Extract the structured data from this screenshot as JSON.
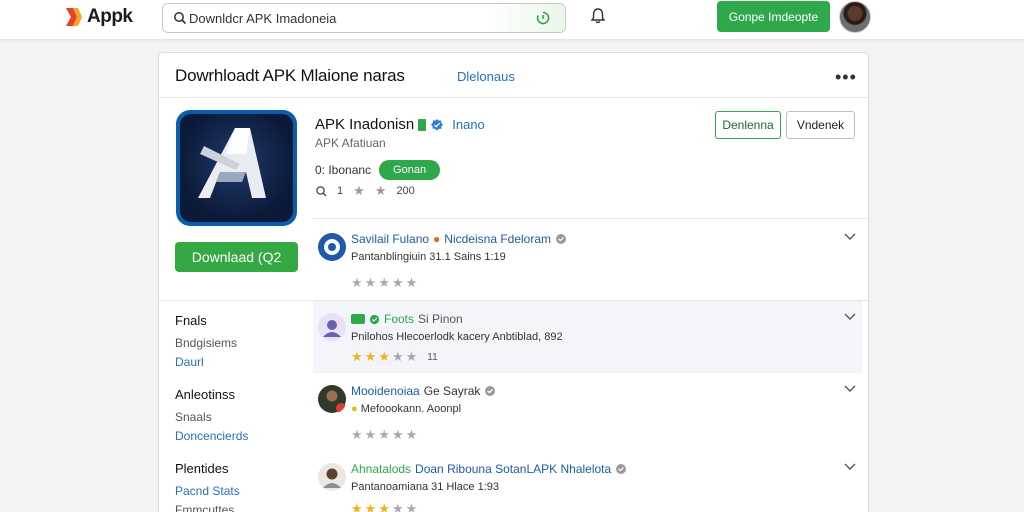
{
  "topbar": {
    "logo_text": "Αppk",
    "search_value": "Downldcr APK Imadoneia",
    "cta_label": "Gonpe Imdeopte",
    "icons": [
      "logo-icon",
      "search-icon",
      "refresh-icon",
      "bell-icon",
      "avatar"
    ]
  },
  "card": {
    "title": "Dowrhloadt APK Mlaione naras",
    "breadcrumb": "Dlelonaus",
    "more": "•••"
  },
  "app": {
    "name": "APK Inadonisn",
    "developer": "Inano",
    "subtitle": "APK Afatiuan",
    "meta_label": "0: Ibonanc",
    "pill_label": "Gonan",
    "stats_a": "1",
    "stats_b": "200",
    "download_label": "Downlaad  (Q2",
    "btn_primary": "Denlenna",
    "btn_secondary": "Vndenek"
  },
  "sidebar": {
    "groups": [
      {
        "head": "Fnals",
        "links": [
          {
            "label": "Bndgisiems",
            "style": "gray"
          },
          {
            "label": "Daurl",
            "style": "blue"
          }
        ]
      },
      {
        "head": "Anleotinss",
        "links": [
          {
            "label": "Snaals",
            "style": "gray"
          },
          {
            "label": "Doncencierds",
            "style": "blue"
          }
        ]
      },
      {
        "head": "Plentides",
        "links": [
          {
            "label": "Pacnd Stats",
            "style": "blue"
          },
          {
            "label": "Fmmcuttes",
            "style": "gray"
          }
        ]
      }
    ]
  },
  "reviews": [
    {
      "name_a": "Savilail Fulano",
      "name_b": "Nicdeisna Fdeloram",
      "body": "Pantanblingiuin 31.1 Sains 1:19",
      "stars": 0,
      "count": ""
    },
    {
      "name_a": "Foots",
      "name_b": "Si Pinon",
      "body": "Pnilohos Hlecoerlodk kacery Anbtiblad, 892",
      "stars": 3,
      "count": "11"
    },
    {
      "name_a": "Mooidenoiaa",
      "name_b": "Ge Sayrak",
      "body": "Mefoookann. Aoonpl",
      "stars": 0,
      "count": ""
    },
    {
      "name_a": "Ahnatalods",
      "name_b": "Doan Ribouna SotanLAPK Nhalelota",
      "body": "Pantanoamiana 31 Hlace 1:93",
      "stars": 3,
      "count": ""
    }
  ],
  "colors": {
    "accent_green": "#2ea84a",
    "link_blue": "#2a6fb8",
    "star_gold": "#f2b01e"
  }
}
